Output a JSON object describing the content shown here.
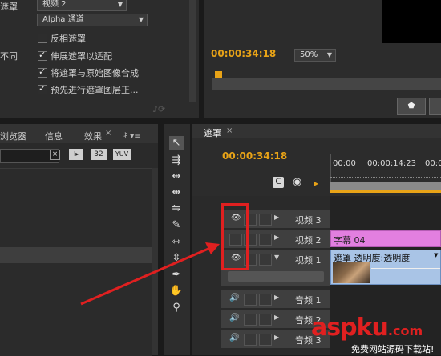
{
  "effect_controls": {
    "label_cut_1": "遮罩",
    "video_select": "视频 2",
    "alpha_select": "Alpha 通道",
    "invert_label": "反相遮罩",
    "label_cut_2": "不同",
    "stretch_label": "伸展遮罩以适配",
    "composite_label": "将遮罩与原始图像合成",
    "premultiply_label": "预先进行遮罩图层正..."
  },
  "program_monitor": {
    "timecode": "00:00:34:18",
    "zoom": "50%"
  },
  "effects_panel": {
    "tabs": [
      "浏览器",
      "信息",
      "效果"
    ],
    "badge_32": "32",
    "badge_yuv": "YUV"
  },
  "timeline": {
    "tab": "遮罩",
    "timecode": "00:00:34:18",
    "ruler": [
      "00:00",
      "00:00:14:23",
      "00:0"
    ],
    "tracks": [
      {
        "name": "视频 3",
        "eye": true
      },
      {
        "name": "视频 2",
        "eye": false
      },
      {
        "name": "视频 1",
        "eye": true
      },
      {
        "name": "音频 1"
      },
      {
        "name": "音频 2"
      },
      {
        "name": "音频 3"
      }
    ],
    "clip_title": "字幕 04",
    "clip_mask": "遮罩  透明度:透明度"
  },
  "watermark": {
    "brand": "aspku",
    "tld": ".com",
    "tagline": "免费网站源码下载站!"
  },
  "colors": {
    "timecode": "#e8a317",
    "title_clip": "#e27fe0",
    "mask_clip": "#a9c4e6",
    "highlight": "#e02020"
  }
}
